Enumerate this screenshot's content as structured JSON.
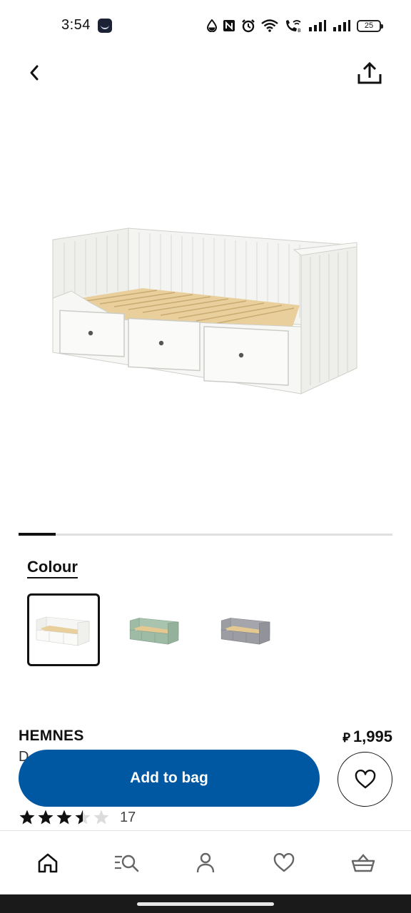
{
  "status_bar": {
    "time": "3:54",
    "battery": "25",
    "icons": [
      "app-notification-icon",
      "data-saver-icon",
      "nfc-icon",
      "alarm-icon",
      "wifi-icon",
      "wifi-calling-icon",
      "signal-icon",
      "signal-icon"
    ]
  },
  "header": {
    "back_icon": "chevron-left-icon",
    "share_icon": "share-icon"
  },
  "carousel": {
    "current_position": 0.1
  },
  "colour": {
    "label": "Colour",
    "options": [
      {
        "name": "white",
        "color": "#f2f2ef",
        "selected": true
      },
      {
        "name": "green",
        "color": "#9dbba5",
        "selected": false
      },
      {
        "name": "grey",
        "color": "#9c9ca3",
        "selected": false
      }
    ]
  },
  "product": {
    "name": "HEMNES",
    "description_visible": "D",
    "currency_symbol": "⃁",
    "price": "1,995",
    "rating": 3.5,
    "rating_max": 5,
    "review_count": "17"
  },
  "actions": {
    "add_to_bag": "Add to bag",
    "favourite_icon": "heart-icon"
  },
  "bottom_nav": {
    "items": [
      {
        "name": "home",
        "icon": "home-icon",
        "active": true
      },
      {
        "name": "search",
        "icon": "search-icon"
      },
      {
        "name": "profile",
        "icon": "profile-icon"
      },
      {
        "name": "favourites",
        "icon": "heart-icon"
      },
      {
        "name": "bag",
        "icon": "basket-icon"
      }
    ]
  },
  "colors": {
    "accent": "#0058a3",
    "text": "#111111"
  }
}
